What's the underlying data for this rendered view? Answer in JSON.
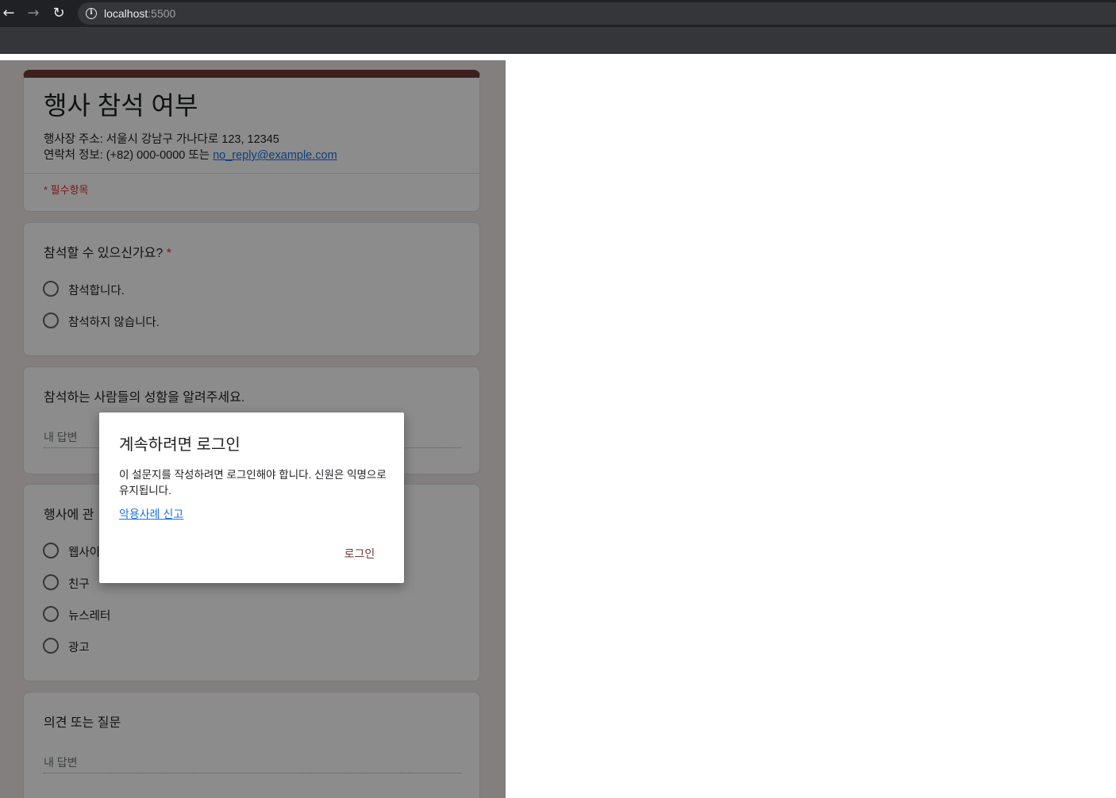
{
  "browser": {
    "url_host": "localhost",
    "url_port": ":5500",
    "back_icon": "←",
    "forward_icon": "→",
    "reload_icon": "↻",
    "info_icon": "i"
  },
  "form": {
    "title": "행사 참석 여부",
    "address_line": "행사장 주소: 서울시 강남구 가나다로 123, 12345",
    "contact_prefix": "연락처 정보: (+82) 000-0000 또는 ",
    "contact_email": "no_reply@example.com",
    "required_note": "* 필수항목",
    "accent_color": "#6d3b37",
    "q1": {
      "title": "참석할 수 있으신가요?",
      "required_mark": "*",
      "options": [
        "참석합니다.",
        "참석하지 않습니다."
      ]
    },
    "q2": {
      "title": "참석하는 사람들의 성함을 알려주세요.",
      "placeholder": "내 답변"
    },
    "q3": {
      "title": "행사에 관",
      "options": [
        "웹사이",
        "친구",
        "뉴스레터",
        "광고"
      ]
    },
    "q4": {
      "title": "의견 또는 질문",
      "placeholder": "내 답변"
    }
  },
  "dialog": {
    "title": "계속하려면 로그인",
    "body": "이 설문지를 작성하려면 로그인해야 합니다. 신원은 익명으로 유지됩니다.",
    "report_link": "악용사례 신고",
    "login_button": "로그인"
  }
}
